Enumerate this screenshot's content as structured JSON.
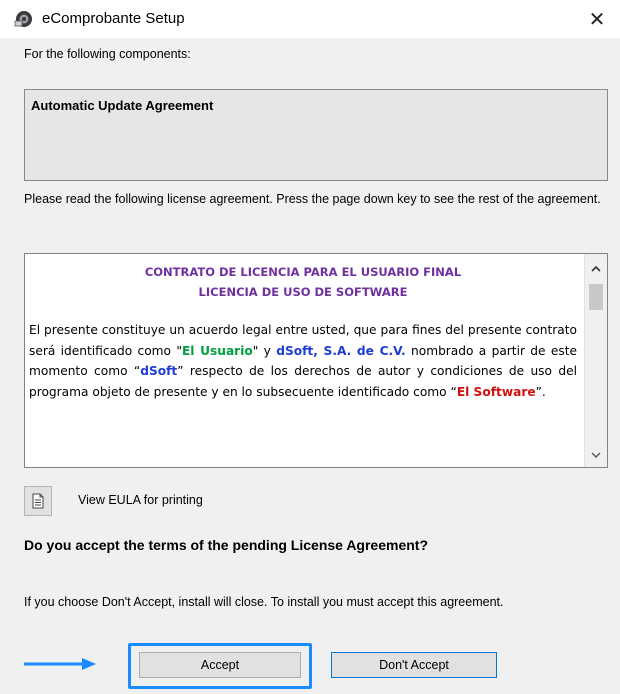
{
  "window": {
    "title": "eComprobante Setup",
    "close_glyph": "✕"
  },
  "intro": "For the following components:",
  "components": {
    "title": "Automatic Update Agreement"
  },
  "instructions": "Please read the following license agreement. Press the page down key to see the rest of the agreement.",
  "license": {
    "heading_line1": "CONTRATO DE LICENCIA PARA EL USUARIO FINAL",
    "heading_line2": "LICENCIA DE USO DE SOFTWARE",
    "para_1": "El presente constituye un acuerdo legal entre usted, que para fines del presente contrato será identificado como \"",
    "term_usuario": "El Usuario",
    "para_2": "\" y ",
    "term_dsoft_full": "dSoft, S.A. de C.V.",
    "para_3": " nombrado a partir de este momento como “",
    "term_dsoft": "dSoft",
    "para_4": "” respecto de los derechos de autor y condiciones de uso del programa objeto de presente y en lo subsecuente identificado como “",
    "term_software": "El Software",
    "para_5": "”.",
    "colors": {
      "heading": "#7030a0",
      "usuario": "#00a040",
      "dsoft": "#1f3dd6",
      "software": "#d01010"
    }
  },
  "print": {
    "icon": "document-icon",
    "label": "View EULA for printing"
  },
  "question": "Do you accept the terms of the pending License Agreement?",
  "note": "If you choose Don't Accept, install will close. To install you must accept this agreement.",
  "buttons": {
    "accept": "Accept",
    "dont_accept": "Don't Accept"
  },
  "annotation": {
    "arrow_color": "#1a8cff",
    "highlight_color": "#1a8cff"
  }
}
